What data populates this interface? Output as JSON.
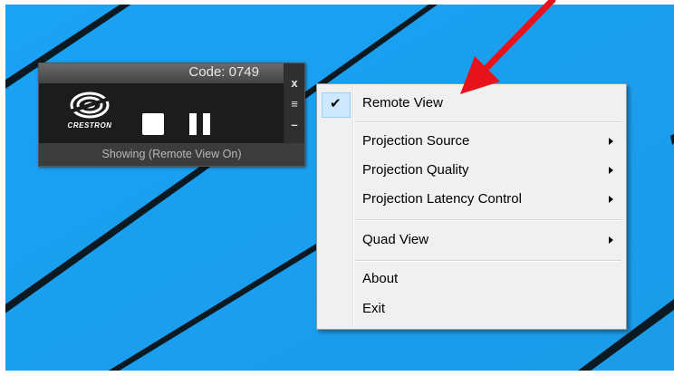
{
  "desktop": {
    "background_color": "#1ea0f0",
    "stripe_color": "#0b1a22"
  },
  "widget": {
    "code_label": "Code: 0749",
    "logo_text": "CRESTRON",
    "close_symbol": "x",
    "menu_symbol": "≡",
    "minimize_symbol": "–",
    "status_text": "Showing (Remote View On)"
  },
  "context_menu": {
    "items": [
      {
        "label": "Remote View",
        "checked": true,
        "submenu": false
      },
      {
        "label": "Projection Source",
        "checked": false,
        "submenu": true
      },
      {
        "label": "Projection Quality",
        "checked": false,
        "submenu": true
      },
      {
        "label": "Projection Latency Control",
        "checked": false,
        "submenu": true
      },
      {
        "label": "Quad View",
        "checked": false,
        "submenu": true
      },
      {
        "label": "About",
        "checked": false,
        "submenu": false
      },
      {
        "label": "Exit",
        "checked": false,
        "submenu": false
      }
    ],
    "check_symbol": "✔"
  },
  "annotation": {
    "arrow_color": "#e8121a"
  }
}
